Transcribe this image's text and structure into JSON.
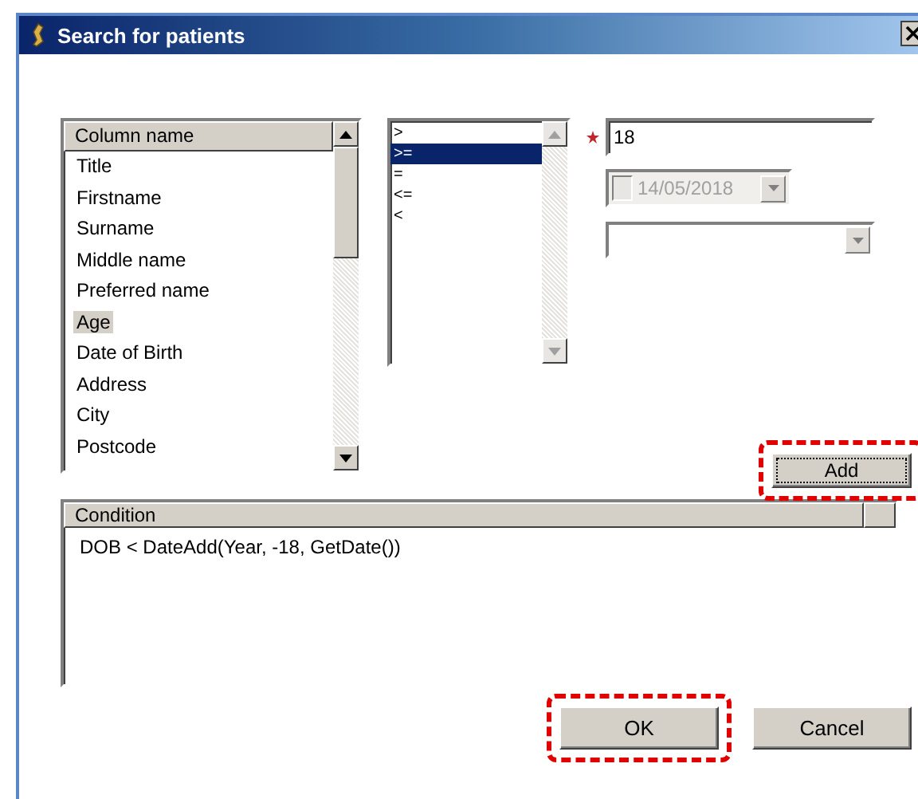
{
  "window": {
    "title": "Search for patients"
  },
  "column_list": {
    "header": "Column name",
    "items": [
      {
        "label": "Title",
        "selected": false
      },
      {
        "label": "Firstname",
        "selected": false
      },
      {
        "label": "Surname",
        "selected": false
      },
      {
        "label": "Middle name",
        "selected": false
      },
      {
        "label": "Preferred name",
        "selected": false
      },
      {
        "label": "Age",
        "selected": true
      },
      {
        "label": "Date of Birth",
        "selected": false
      },
      {
        "label": "Address",
        "selected": false
      },
      {
        "label": "City",
        "selected": false
      },
      {
        "label": "Postcode",
        "selected": false
      }
    ]
  },
  "operator_list": {
    "items": [
      {
        "label": ">",
        "selected": false
      },
      {
        "label": ">=",
        "selected": true
      },
      {
        "label": "=",
        "selected": false
      },
      {
        "label": "<=",
        "selected": false
      },
      {
        "label": "<",
        "selected": false
      }
    ]
  },
  "value_field": {
    "required": true,
    "value": "18"
  },
  "date_picker": {
    "value": "14/05/2018",
    "checked": false,
    "disabled": true
  },
  "add_button": {
    "label": "Add",
    "highlighted": true
  },
  "conditions": {
    "header": "Condition",
    "rows": [
      "DOB < DateAdd(Year, -18, GetDate())"
    ]
  },
  "buttons": [
    {
      "label": "OK",
      "highlighted": true
    },
    {
      "label": "Cancel",
      "highlighted": false
    }
  ]
}
